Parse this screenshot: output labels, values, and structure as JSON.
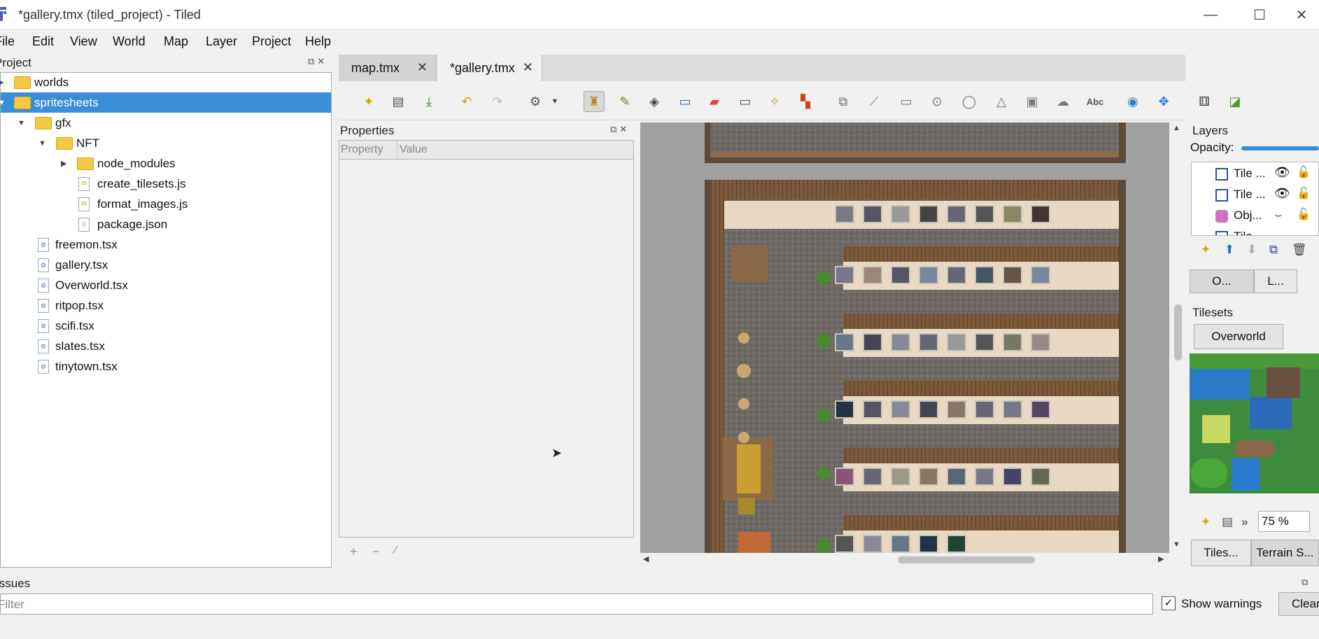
{
  "window": {
    "title": "*gallery.tmx (tiled_project) - Tiled",
    "minimize": "—",
    "maximize": "☐",
    "close": "✕"
  },
  "menu": [
    "File",
    "Edit",
    "View",
    "World",
    "Map",
    "Layer",
    "Project",
    "Help"
  ],
  "project_panel": {
    "title": "Project",
    "tree": [
      {
        "label": "worlds",
        "type": "folder",
        "depth": 0,
        "expanded": false
      },
      {
        "label": "spritesheets",
        "type": "folder",
        "depth": 0,
        "expanded": true,
        "selected": true
      },
      {
        "label": "gfx",
        "type": "folder",
        "depth": 1,
        "expanded": true
      },
      {
        "label": "NFT",
        "type": "folder",
        "depth": 2,
        "expanded": true
      },
      {
        "label": "node_modules",
        "type": "folder",
        "depth": 3,
        "expanded": false
      },
      {
        "label": "create_tilesets.js",
        "type": "js",
        "depth": 3
      },
      {
        "label": "format_images.js",
        "type": "js",
        "depth": 3
      },
      {
        "label": "package.json",
        "type": "json",
        "depth": 3
      },
      {
        "label": "freemon.tsx",
        "type": "tsx",
        "depth": 1
      },
      {
        "label": "gallery.tsx",
        "type": "tsx",
        "depth": 1
      },
      {
        "label": "Overworld.tsx",
        "type": "tsx",
        "depth": 1
      },
      {
        "label": "ritpop.tsx",
        "type": "tsx",
        "depth": 1
      },
      {
        "label": "scifi.tsx",
        "type": "tsx",
        "depth": 1
      },
      {
        "label": "slates.tsx",
        "type": "tsx",
        "depth": 1
      },
      {
        "label": "tinytown.tsx",
        "type": "tsx",
        "depth": 1
      }
    ]
  },
  "tabs": [
    {
      "label": "map.tmx",
      "active": false
    },
    {
      "label": "*gallery.tmx",
      "active": true
    }
  ],
  "properties_panel": {
    "title": "Properties",
    "col_property": "Property",
    "col_value": "Value"
  },
  "layers_panel": {
    "title": "Layers",
    "opacity_label": "Opacity:",
    "layers": [
      {
        "name": "Tile ...",
        "icon": "tile-layer-icon"
      },
      {
        "name": "Tile ...",
        "icon": "tile-layer-icon"
      },
      {
        "name": "Obj...",
        "icon": "object-layer-icon"
      },
      {
        "name": "Tile ...",
        "icon": "tile-layer-icon"
      }
    ],
    "tabs": [
      "O...",
      "L..."
    ]
  },
  "tilesets_panel": {
    "title": "Tilesets",
    "current": "Overworld",
    "zoom": "75 %",
    "bottom_tabs": [
      "Tiles...",
      "Terrain S..."
    ]
  },
  "issues_panel": {
    "title": "Issues",
    "filter_placeholder": "Filter",
    "show_warnings": "Show warnings",
    "clear": "Clear",
    "show_warnings_checked": true
  },
  "colors": {
    "selection": "#3a8ed7",
    "folder": "#f5c842",
    "wood": "#7a5a3a",
    "floor": "#6f6a66"
  }
}
